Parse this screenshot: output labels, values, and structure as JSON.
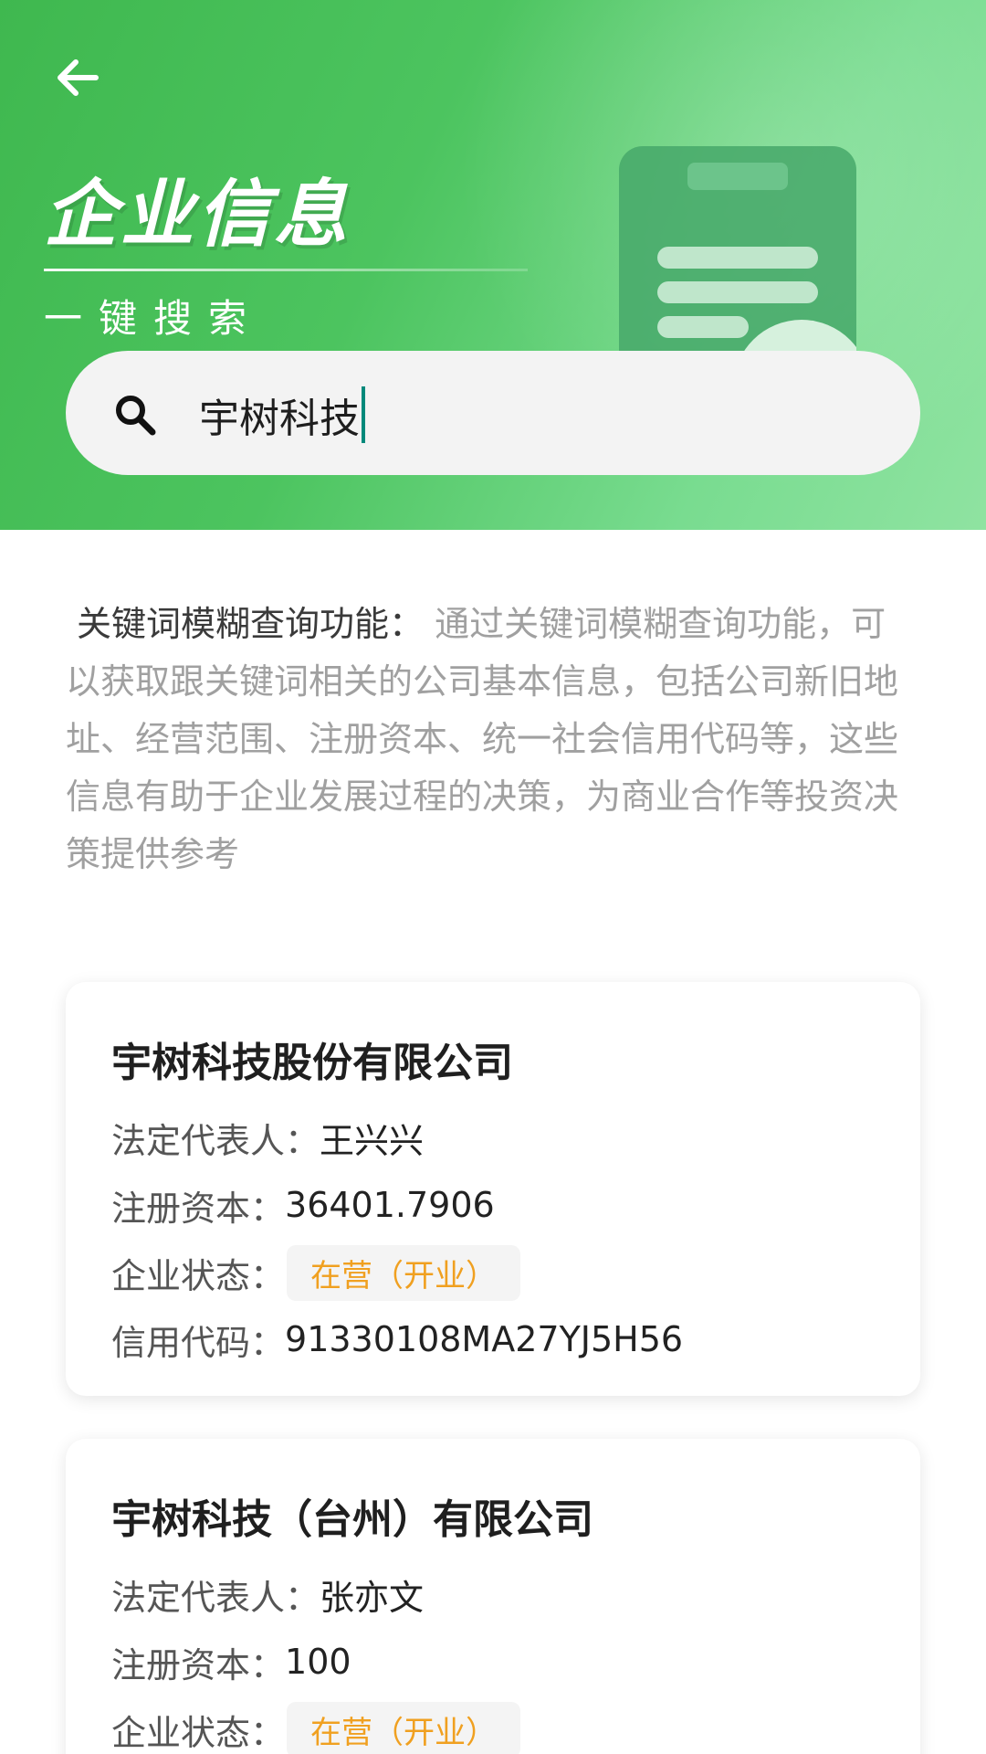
{
  "header": {
    "title": "企业信息",
    "subtitle": "一键搜索",
    "back_icon": "arrow-left-icon",
    "illustration_icon": "clipboard-icon"
  },
  "search": {
    "icon": "search-icon",
    "value": "宇树科技"
  },
  "description": {
    "label": "关键词模糊查询功能：",
    "text": " 通过关键词模糊查询功能，可以获取跟关键词相关的公司基本信息，包括公司新旧地址、经营范围、注册资本、统一社会信用代码等，这些信息有助于企业发展过程的决策，为商业合作等投资决策提供参考"
  },
  "labels": {
    "legal_rep": "法定代表人：",
    "capital": "注册资本：",
    "status": "企业状态：",
    "credit_code": "信用代码："
  },
  "results": [
    {
      "name": "宇树科技股份有限公司",
      "legal_rep": " 王兴兴",
      "capital": "36401.7906",
      "status": "在营（开业）",
      "credit_code": "91330108MA27YJ5H56"
    },
    {
      "name": "宇树科技（台州）有限公司",
      "legal_rep": " 张亦文",
      "capital": "100",
      "status": "在营（开业）"
    }
  ],
  "colors": {
    "header_green": "#4cc45f",
    "status_orange": "#f0a020",
    "caret": "#00897b"
  }
}
